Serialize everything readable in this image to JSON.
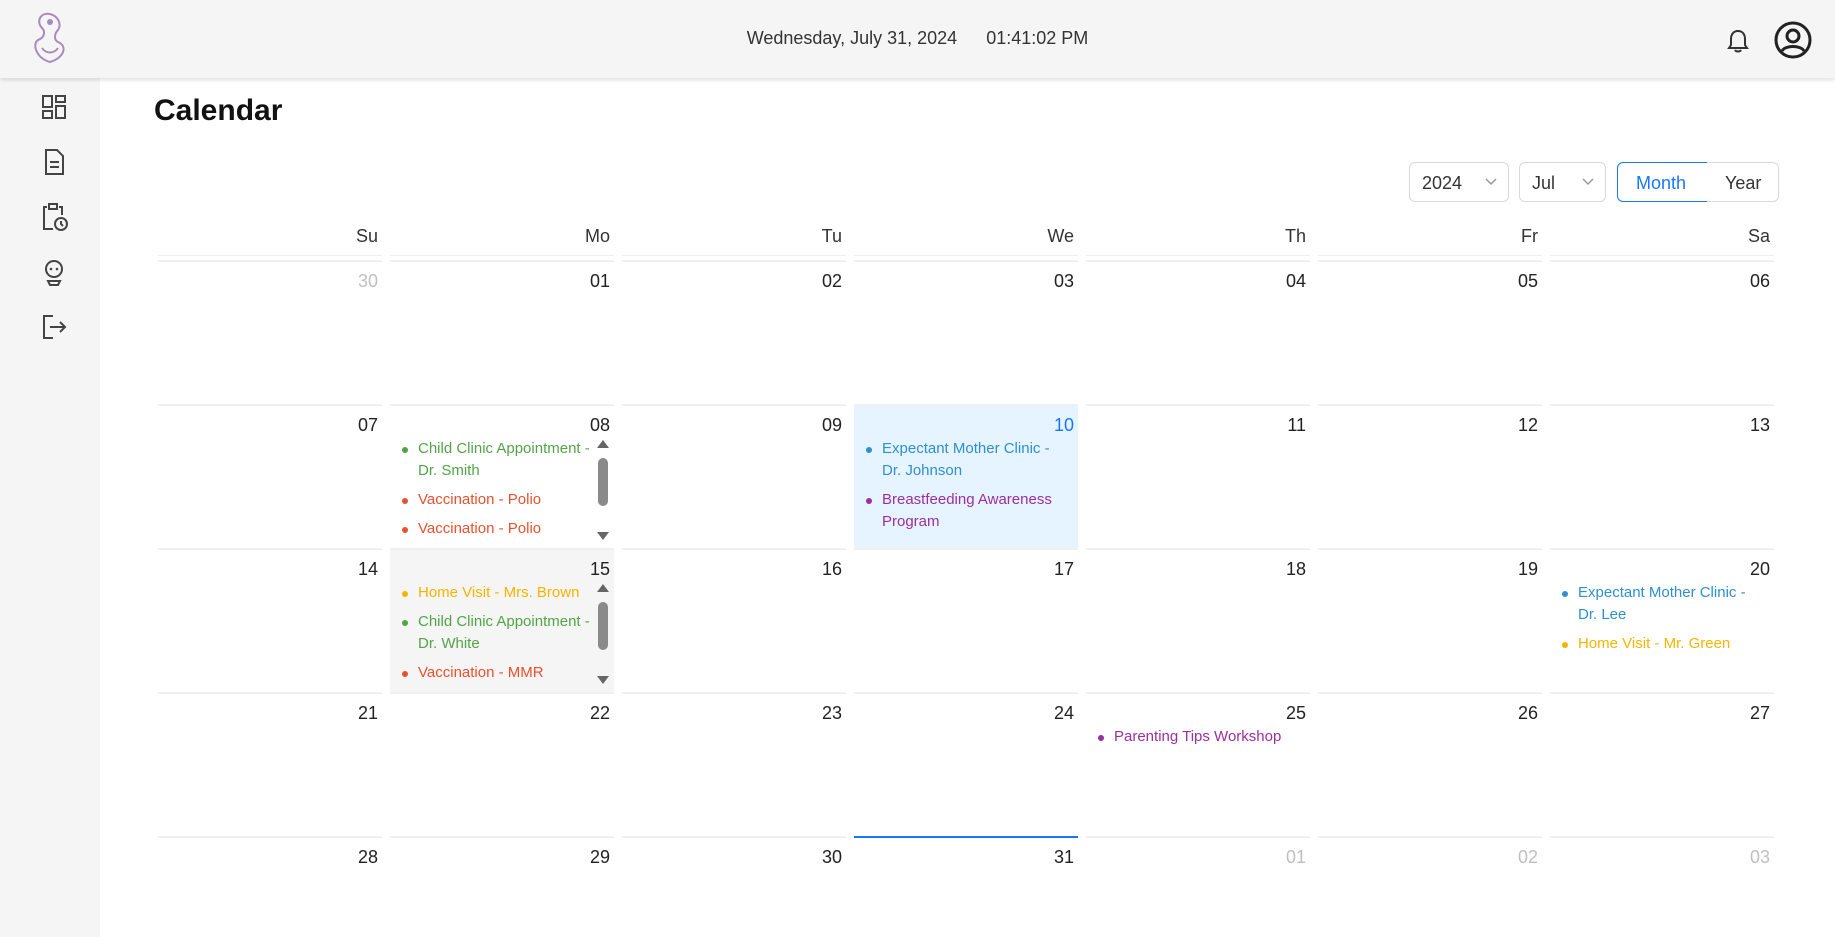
{
  "header": {
    "date": "Wednesday, July 31, 2024",
    "time": "01:41:02 PM"
  },
  "sidebar": {
    "items": [
      {
        "icon": "dashboard-icon"
      },
      {
        "icon": "document-icon"
      },
      {
        "icon": "clipboard-clock-icon"
      },
      {
        "icon": "baby-icon"
      },
      {
        "icon": "logout-icon"
      }
    ]
  },
  "page": {
    "title": "Calendar"
  },
  "controls": {
    "year": "2024",
    "month": "Jul",
    "mode_month": "Month",
    "mode_year": "Year",
    "selected_mode": "Month"
  },
  "colors": {
    "accent": "#1677ff",
    "green": "#52a447",
    "red": "#e8502f",
    "yellow": "#f5b400",
    "blue": "#2e8fd1",
    "purple": "#9b2fa0"
  },
  "calendar": {
    "weekdays": [
      "Su",
      "Mo",
      "Tu",
      "We",
      "Th",
      "Fr",
      "Sa"
    ],
    "days": [
      {
        "num": "30",
        "other": true,
        "events": []
      },
      {
        "num": "01",
        "events": []
      },
      {
        "num": "02",
        "events": []
      },
      {
        "num": "03",
        "events": []
      },
      {
        "num": "04",
        "events": []
      },
      {
        "num": "05",
        "events": []
      },
      {
        "num": "06",
        "events": []
      },
      {
        "num": "07",
        "events": []
      },
      {
        "num": "08",
        "scroll": true,
        "events": [
          {
            "title": "Child Clinic Appointment - Dr. Smith",
            "color": "green"
          },
          {
            "title": "Vaccination - Polio",
            "color": "red"
          },
          {
            "title": "Vaccination - Polio",
            "color": "red"
          }
        ]
      },
      {
        "num": "09",
        "events": []
      },
      {
        "num": "10",
        "selected": true,
        "events": [
          {
            "title": "Expectant Mother Clinic - Dr. Johnson",
            "color": "blue"
          },
          {
            "title": "Breastfeeding Awareness Program",
            "color": "purple"
          }
        ]
      },
      {
        "num": "11",
        "events": []
      },
      {
        "num": "12",
        "events": []
      },
      {
        "num": "13",
        "events": []
      },
      {
        "num": "14",
        "events": []
      },
      {
        "num": "15",
        "hover": true,
        "scroll": true,
        "events": [
          {
            "title": "Home Visit - Mrs. Brown",
            "color": "yellow"
          },
          {
            "title": "Child Clinic Appointment - Dr. White",
            "color": "green"
          },
          {
            "title": "Vaccination - MMR",
            "color": "red"
          }
        ]
      },
      {
        "num": "16",
        "events": []
      },
      {
        "num": "17",
        "events": []
      },
      {
        "num": "18",
        "events": []
      },
      {
        "num": "19",
        "events": []
      },
      {
        "num": "20",
        "events": [
          {
            "title": "Expectant Mother Clinic - Dr. Lee",
            "color": "blue"
          },
          {
            "title": "Home Visit - Mr. Green",
            "color": "yellow"
          }
        ]
      },
      {
        "num": "21",
        "events": []
      },
      {
        "num": "22",
        "events": []
      },
      {
        "num": "23",
        "events": []
      },
      {
        "num": "24",
        "events": []
      },
      {
        "num": "25",
        "events": [
          {
            "title": "Parenting Tips Workshop",
            "color": "purple"
          }
        ]
      },
      {
        "num": "26",
        "events": []
      },
      {
        "num": "27",
        "events": []
      },
      {
        "num": "28",
        "events": []
      },
      {
        "num": "29",
        "events": []
      },
      {
        "num": "30",
        "events": []
      },
      {
        "num": "31",
        "today": true,
        "events": []
      },
      {
        "num": "01",
        "other": true,
        "events": []
      },
      {
        "num": "02",
        "other": true,
        "events": []
      },
      {
        "num": "03",
        "other": true,
        "events": []
      }
    ]
  }
}
